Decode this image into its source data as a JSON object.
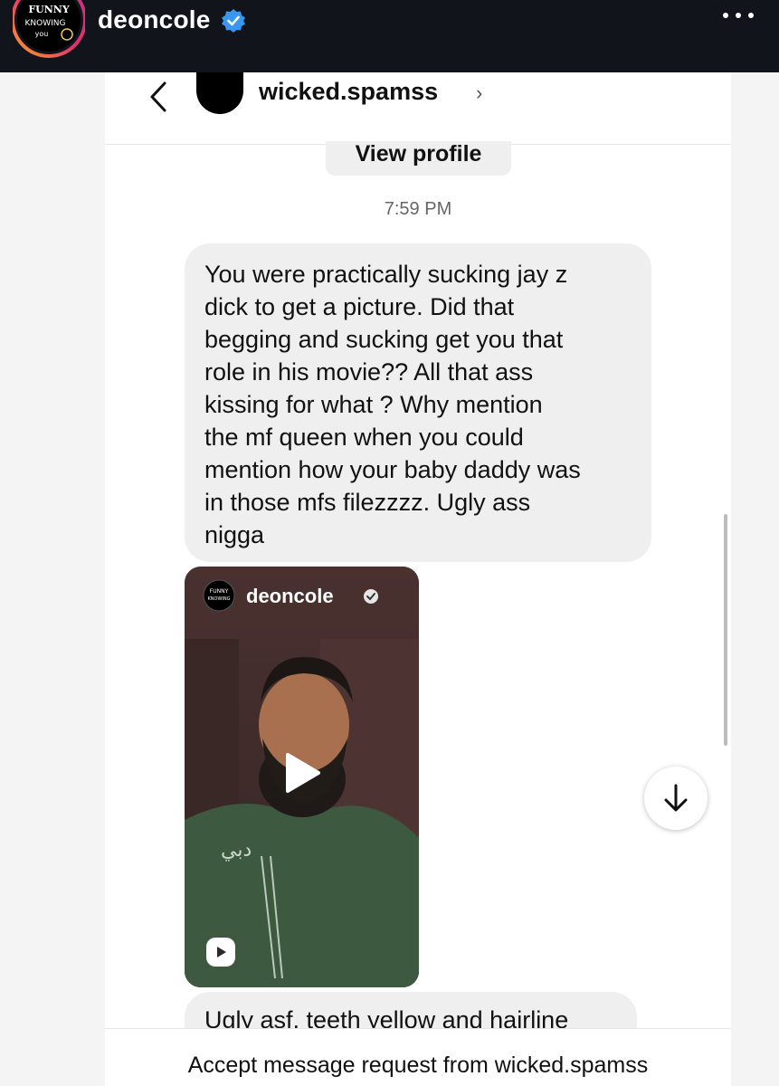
{
  "story": {
    "username": "deoncole",
    "logo_text": "FUNNY KNOWING YOU"
  },
  "dm": {
    "contact_name": "wicked.spamss",
    "view_profile_label": "View profile",
    "time": "7:59 PM",
    "message": [
      "You were practically sucking jay z",
      "dick to get a picture. Did that",
      "begging and sucking get you that",
      "role in his movie?? All that ass",
      "kissing for what ? Why mention",
      "the mf queen when you could",
      "mention how your baby daddy was",
      "in those mfs filezzzz. Ugly ass",
      "nigga"
    ],
    "shared_video": {
      "username": "deoncole"
    },
    "next_message_partial": "Ugly asf, teeth yellow and hairline",
    "request_text": "Accept message request from wicked.spamss"
  },
  "colors": {
    "top_bar": "#11151b",
    "bubble": "#efefef",
    "verified": "#3897f0"
  }
}
